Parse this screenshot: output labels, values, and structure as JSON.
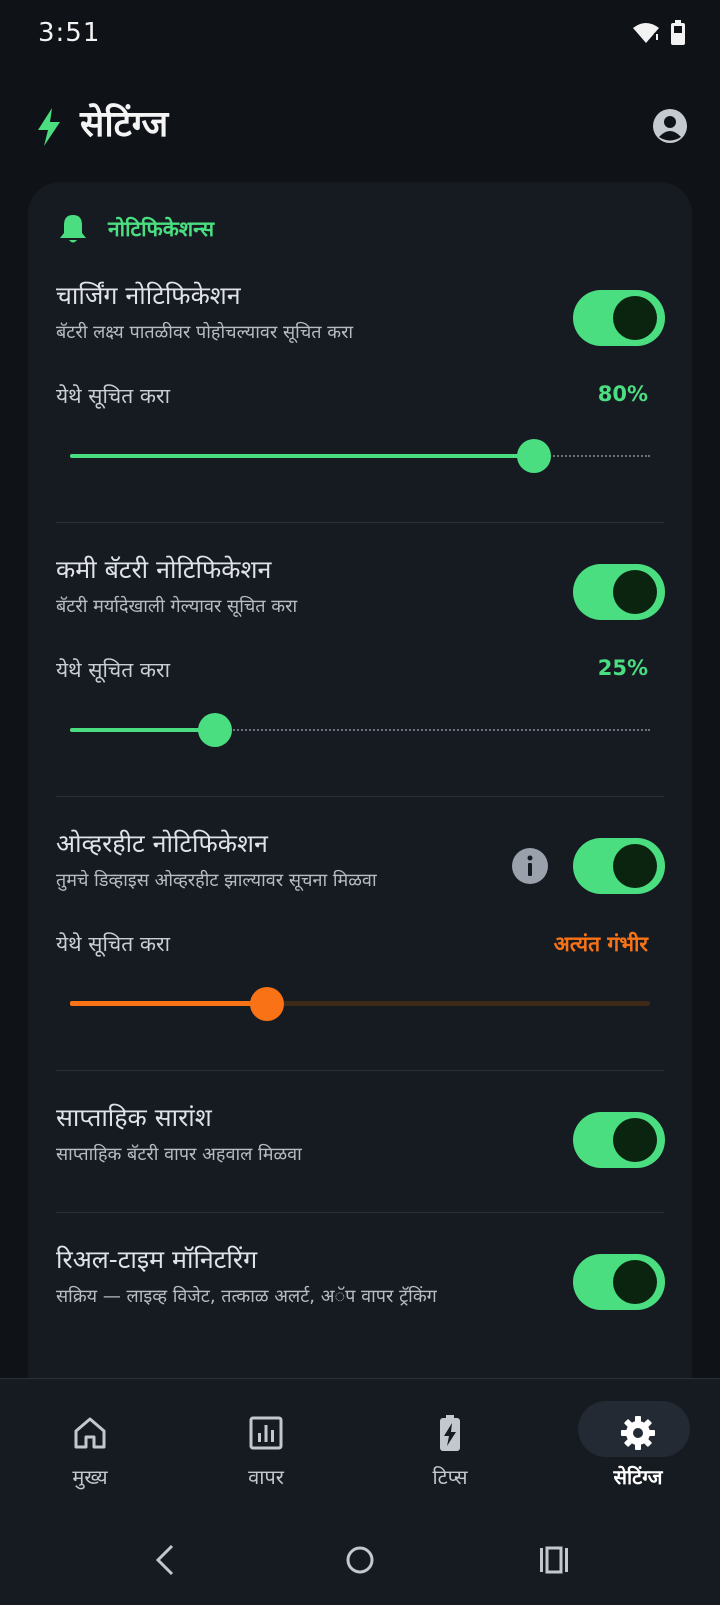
{
  "status_bar": {
    "time": "3:51"
  },
  "header": {
    "title": "सेटिंग्ज"
  },
  "section": {
    "title": "नोटिफिकेशन्स"
  },
  "rows": [
    {
      "title": "चार्जिंग नोटिफिकेशन",
      "subtitle": "बॅटरी लक्ष्य पातळीवर पोहोचल्यावर सूचित करा",
      "toggle_on": true,
      "notify_label": "येथे सूचित करा",
      "notify_value": "80%",
      "slider_level": 0.8
    },
    {
      "title": "कमी बॅटरी नोटिफिकेशन",
      "subtitle": "बॅटरी मर्यादेखाली गेल्यावर सूचित करा",
      "toggle_on": true,
      "notify_label": "येथे सूचित करा",
      "notify_value": "25%",
      "slider_level": 0.25
    },
    {
      "title": "ओव्हरहीट नोटिफिकेशन",
      "subtitle": "तुमचे डिव्हाइस ओव्हरहीट झाल्यावर सूचना मिळवा",
      "toggle_on": true,
      "notify_label": "येथे सूचित करा",
      "notify_value": "अत्यंत गंभीर",
      "slider_level": 0.34
    },
    {
      "title": "साप्ताहिक सारांश",
      "subtitle": "साप्ताहिक बॅटरी वापर अहवाल मिळवा",
      "toggle_on": true
    },
    {
      "title": "रिअल-टाइम मॉनिटरिंग",
      "subtitle": "सक्रिय — लाइव्ह विजेट, तत्काळ अलर्ट, अॅप वापर ट्रॅकिंग",
      "toggle_on": true
    }
  ],
  "nav": {
    "items": [
      {
        "label": "मुख्य",
        "icon": "home-icon"
      },
      {
        "label": "वापर",
        "icon": "chart-icon"
      },
      {
        "label": "टिप्स",
        "icon": "battery-bolt-icon"
      },
      {
        "label": "सेटिंग्ज",
        "icon": "gear-icon",
        "active": true
      }
    ]
  },
  "colors": {
    "accent": "#4ade80",
    "warning": "#f97316",
    "background": "#0f1318",
    "card": "#161b22"
  }
}
